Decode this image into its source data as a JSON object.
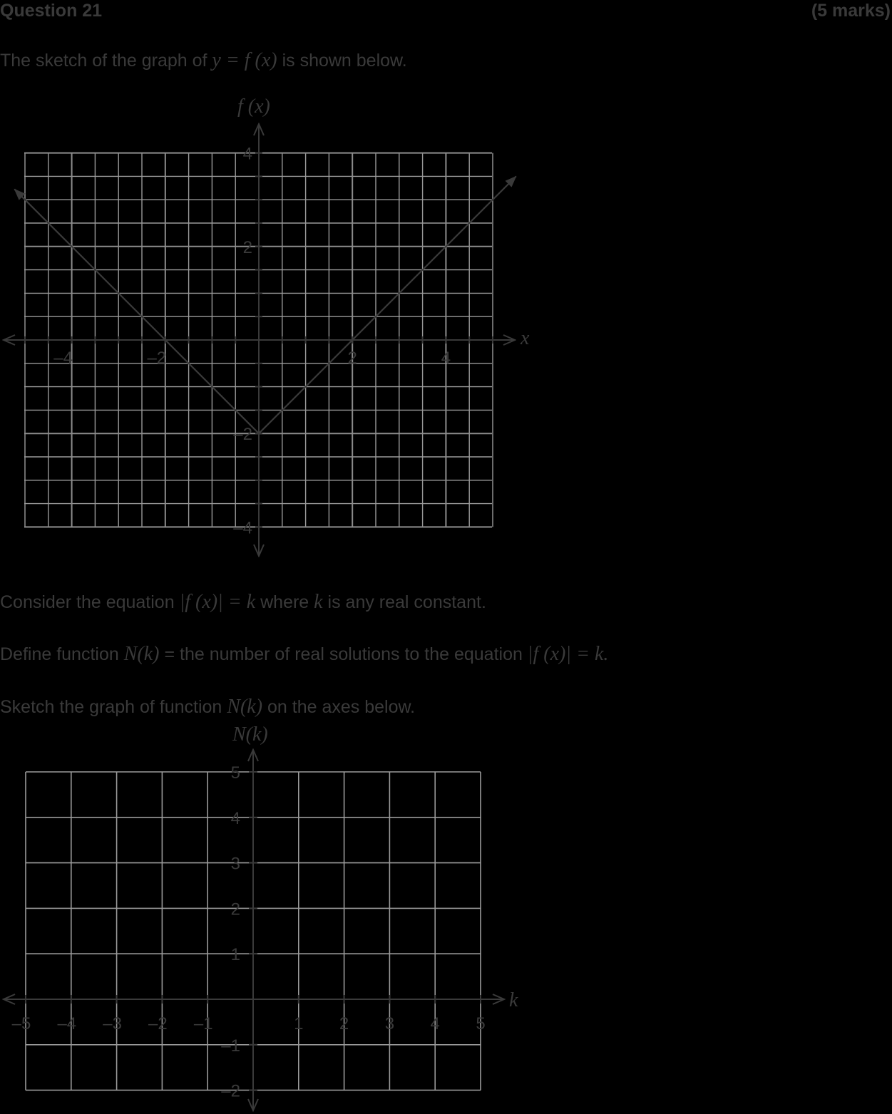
{
  "header": {
    "question": "Question 21",
    "marks": "(5 marks)"
  },
  "intro": {
    "before": "The sketch of the graph of",
    "math": "y = f (x)",
    "after": "is shown below."
  },
  "graph1": {
    "y_axis_label": "f (x)",
    "x_axis_label": "x",
    "x_ticks": [
      "–4",
      "–2",
      "2",
      "4"
    ],
    "y_ticks": [
      "4",
      "2",
      "–2",
      "–4"
    ]
  },
  "consider": {
    "before": "Consider the equation",
    "eq": "|f (x)| = k",
    "mid": "where",
    "k": "k",
    "after": "is any real constant."
  },
  "define": {
    "before": "Define function",
    "fn": "N(k)",
    "mid": "= the number of real solutions to the equation",
    "eq": "|f (x)| = k."
  },
  "sketch": {
    "before": "Sketch the graph of function",
    "fn": "N(k)",
    "after": "on the axes below."
  },
  "graph2": {
    "y_axis_label": "N(k)",
    "x_axis_label": "k",
    "x_ticks": [
      "–5",
      "–4",
      "–3",
      "–2",
      "–1",
      "1",
      "2",
      "3",
      "4",
      "5"
    ],
    "y_ticks": [
      "5",
      "4",
      "3",
      "2",
      "1",
      "–1",
      "–2"
    ]
  },
  "chart_data": [
    {
      "type": "line",
      "x": [
        -5,
        0,
        5
      ],
      "y": [
        3,
        -2,
        3
      ],
      "xlim": [
        -5,
        5
      ],
      "ylim": [
        -4,
        4
      ],
      "xlabel": "x",
      "ylabel": "f (x)",
      "grid": true,
      "minor_grid_step": 0.5
    },
    {
      "type": "line",
      "x": [],
      "y": [],
      "xlim": [
        -5,
        5
      ],
      "ylim": [
        -2,
        5
      ],
      "xlabel": "k",
      "ylabel": "N(k)",
      "grid": true
    }
  ]
}
